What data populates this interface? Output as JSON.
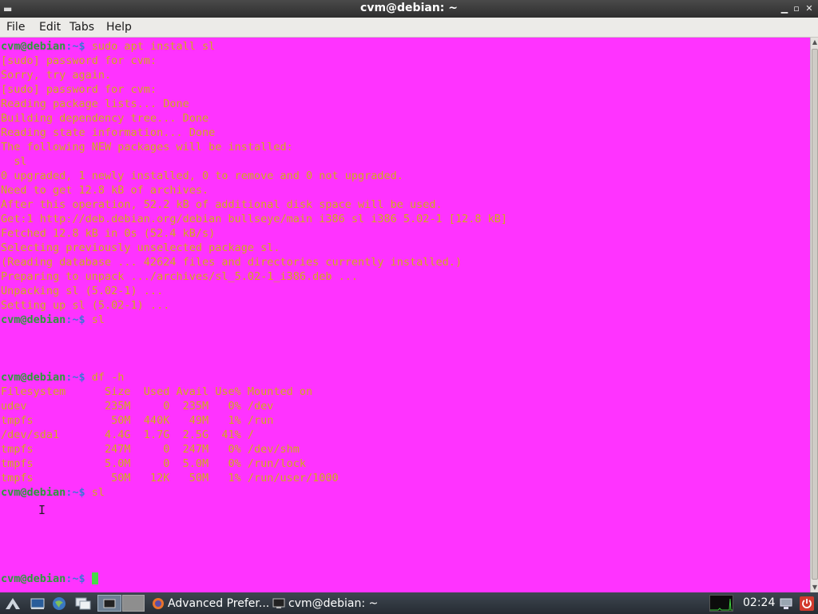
{
  "window": {
    "title": "cvm@debian: ~",
    "controls": {
      "minimize": "▁",
      "maximize": "▫",
      "close": "✕"
    }
  },
  "menu": [
    "File",
    "Edit",
    "Tabs",
    "Help"
  ],
  "terminal": {
    "prompt_user": "cvm@debian",
    "prompt_path": ":~$ ",
    "lines": [
      {
        "kind": "prompt",
        "cmd": "sudo apt install sl"
      },
      {
        "kind": "out",
        "text": "[sudo] password for cvm:"
      },
      {
        "kind": "out",
        "text": "Sorry, try again."
      },
      {
        "kind": "out",
        "text": "[sudo] password for cvm:"
      },
      {
        "kind": "out",
        "text": "Reading package lists... Done"
      },
      {
        "kind": "out",
        "text": "Building dependency tree... Done"
      },
      {
        "kind": "out",
        "text": "Reading state information... Done"
      },
      {
        "kind": "out",
        "text": "The following NEW packages will be installed:"
      },
      {
        "kind": "out",
        "text": "  sl"
      },
      {
        "kind": "out",
        "text": "0 upgraded, 1 newly installed, 0 to remove and 0 not upgraded."
      },
      {
        "kind": "out",
        "text": "Need to get 12.8 kB of archives."
      },
      {
        "kind": "out",
        "text": "After this operation, 52.2 kB of additional disk space will be used."
      },
      {
        "kind": "out",
        "text": "Get:1 http://deb.debian.org/debian bullseye/main i386 sl i386 5.02-1 [12.8 kB]"
      },
      {
        "kind": "out",
        "text": "Fetched 12.8 kB in 0s (52.4 kB/s)"
      },
      {
        "kind": "out",
        "text": "Selecting previously unselected package sl."
      },
      {
        "kind": "out",
        "text": "(Reading database ... 42624 files and directories currently installed.)"
      },
      {
        "kind": "out",
        "text": "Preparing to unpack .../archives/sl_5.02-1_i386.deb ..."
      },
      {
        "kind": "out",
        "text": "Unpacking sl (5.02-1) ..."
      },
      {
        "kind": "out",
        "text": "Setting up sl (5.02-1) ..."
      },
      {
        "kind": "prompt",
        "cmd": "sl"
      },
      {
        "kind": "out",
        "text": ""
      },
      {
        "kind": "out",
        "text": ""
      },
      {
        "kind": "out",
        "text": ""
      },
      {
        "kind": "prompt",
        "cmd": "df -h"
      },
      {
        "kind": "out",
        "text": "Filesystem      Size  Used Avail Use% Mounted on"
      },
      {
        "kind": "out",
        "text": "udev            235M     0  235M   0% /dev"
      },
      {
        "kind": "out",
        "text": "tmpfs            50M  440K   49M   1% /run"
      },
      {
        "kind": "out",
        "text": "/dev/sda1       4.4G  1.7G  2.5G  41% /"
      },
      {
        "kind": "out",
        "text": "tmpfs           247M     0  247M   0% /dev/shm"
      },
      {
        "kind": "out",
        "text": "tmpfs           5.0M     0  5.0M   0% /run/lock"
      },
      {
        "kind": "out",
        "text": "tmpfs            50M   12K   50M   1% /run/user/1000"
      },
      {
        "kind": "prompt",
        "cmd": "sl"
      },
      {
        "kind": "out",
        "text": ""
      },
      {
        "kind": "out",
        "text": ""
      },
      {
        "kind": "out",
        "text": ""
      },
      {
        "kind": "out",
        "text": ""
      },
      {
        "kind": "out",
        "text": ""
      },
      {
        "kind": "prompt",
        "cmd": "",
        "cursor": true
      }
    ],
    "colors": {
      "background": "#ff33ff",
      "output": "#d0ab18",
      "user": "#2c9a3a",
      "path": "#3b76d6",
      "cursor": "#47d847"
    }
  },
  "taskbar": {
    "icons": [
      "start-menu-icon",
      "show-desktop-icon",
      "web-browser-icon",
      "file-manager-icon",
      "terminal-icon",
      "workspace-icon"
    ],
    "tasks": [
      {
        "label": "Advanced Prefer...",
        "icon": "firefox-icon"
      },
      {
        "label": "cvm@debian: ~",
        "icon": "terminal-icon"
      }
    ],
    "clock": "02:24"
  }
}
